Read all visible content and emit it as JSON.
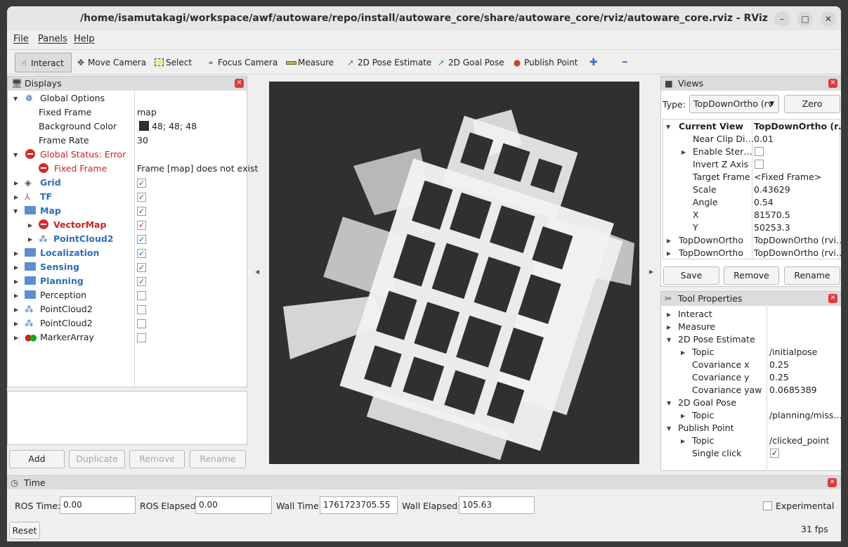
{
  "window": {
    "title": "/home/isamutakagi/workspace/awf/autoware/repo/install/autoware_core/share/autoware_core/rviz/autoware_core.rviz - RViz",
    "controls": {
      "minimize": "–",
      "maximize": "□",
      "close": "✕"
    }
  },
  "menubar": {
    "file": "File",
    "panels": "Panels",
    "help": "Help"
  },
  "toolbar": {
    "interact": "Interact",
    "move_camera": "Move Camera",
    "select": "Select",
    "focus_camera": "Focus Camera",
    "measure": "Measure",
    "pose_estimate": "2D Pose Estimate",
    "goal_pose": "2D Goal Pose",
    "publish_point": "Publish Point",
    "plus": "✚",
    "minus": "━"
  },
  "displays": {
    "title": "Displays",
    "global_options": "Global Options",
    "fixed_frame_label": "Fixed Frame",
    "fixed_frame_value": "map",
    "background_color_label": "Background Color",
    "background_color_value": "48; 48; 48",
    "background_swatch": "#303030",
    "frame_rate_label": "Frame Rate",
    "frame_rate_value": "30",
    "global_status": "Global Status: Error",
    "fixed_frame_error_label": "Fixed Frame",
    "fixed_frame_error_value": "Frame [map] does not exist",
    "items": [
      {
        "label": "Grid",
        "checked": "✓"
      },
      {
        "label": "TF",
        "checked": "✓"
      },
      {
        "label": "Map",
        "checked": "✓"
      },
      {
        "label": "VectorMap",
        "checked": "✓"
      },
      {
        "label": "PointCloud2",
        "checked": "✓"
      },
      {
        "label": "Localization",
        "checked": "✓"
      },
      {
        "label": "Sensing",
        "checked": "✓"
      },
      {
        "label": "Planning",
        "checked": "✓"
      },
      {
        "label": "Perception",
        "checked": ""
      },
      {
        "label": "PointCloud2",
        "checked": ""
      },
      {
        "label": "PointCloud2",
        "checked": ""
      },
      {
        "label": "MarkerArray",
        "checked": ""
      }
    ],
    "buttons": {
      "add": "Add",
      "duplicate": "Duplicate",
      "remove": "Remove",
      "rename": "Rename"
    }
  },
  "views": {
    "title": "Views",
    "type_label": "Type:",
    "type_value": "TopDownOrtho (rv",
    "zero": "Zero",
    "current_view_label": "Current View",
    "current_view_value": "TopDownOrtho (r…",
    "props": [
      {
        "label": "Near Clip Di…",
        "value": "0.01"
      },
      {
        "label": "Enable Ster…",
        "value": ""
      },
      {
        "label": "Invert Z Axis",
        "value": ""
      },
      {
        "label": "Target Frame",
        "value": "<Fixed Frame>"
      },
      {
        "label": "Scale",
        "value": "0.43629"
      },
      {
        "label": "Angle",
        "value": "0.54"
      },
      {
        "label": "X",
        "value": "81570.5"
      },
      {
        "label": "Y",
        "value": "50253.3"
      }
    ],
    "saved": [
      {
        "label": "TopDownOrtho",
        "value": "TopDownOrtho (rvi…"
      },
      {
        "label": "TopDownOrtho",
        "value": "TopDownOrtho (rvi…"
      }
    ],
    "buttons": {
      "save": "Save",
      "remove": "Remove",
      "rename": "Rename"
    }
  },
  "tool_properties": {
    "title": "Tool Properties",
    "interact": "Interact",
    "measure": "Measure",
    "pose_estimate": "2D Pose Estimate",
    "pose_topic_label": "Topic",
    "pose_topic_value": "/initialpose",
    "cov_x_label": "Covariance x",
    "cov_x_value": "0.25",
    "cov_y_label": "Covariance y",
    "cov_y_value": "0.25",
    "cov_yaw_label": "Covariance yaw",
    "cov_yaw_value": "0.0685389",
    "goal_pose": "2D Goal Pose",
    "goal_topic_label": "Topic",
    "goal_topic_value": "/planning/miss…",
    "publish_point": "Publish Point",
    "pp_topic_label": "Topic",
    "pp_topic_value": "/clicked_point",
    "single_click_label": "Single click",
    "single_click_value": "✓"
  },
  "time": {
    "title": "Time",
    "ros_time_label": "ROS Time:",
    "ros_time_value": "0.00",
    "ros_elapsed_label": "ROS Elapsed:",
    "ros_elapsed_value": "0.00",
    "wall_time_label": "Wall Time:",
    "wall_time_value": "1761723705.55",
    "wall_elapsed_label": "Wall Elapsed:",
    "wall_elapsed_value": "105.63",
    "experimental_label": "Experimental",
    "reset": "Reset",
    "fps": "31 fps"
  },
  "viewport": {
    "background": "#303030",
    "map_color": "#f2f2f2"
  }
}
